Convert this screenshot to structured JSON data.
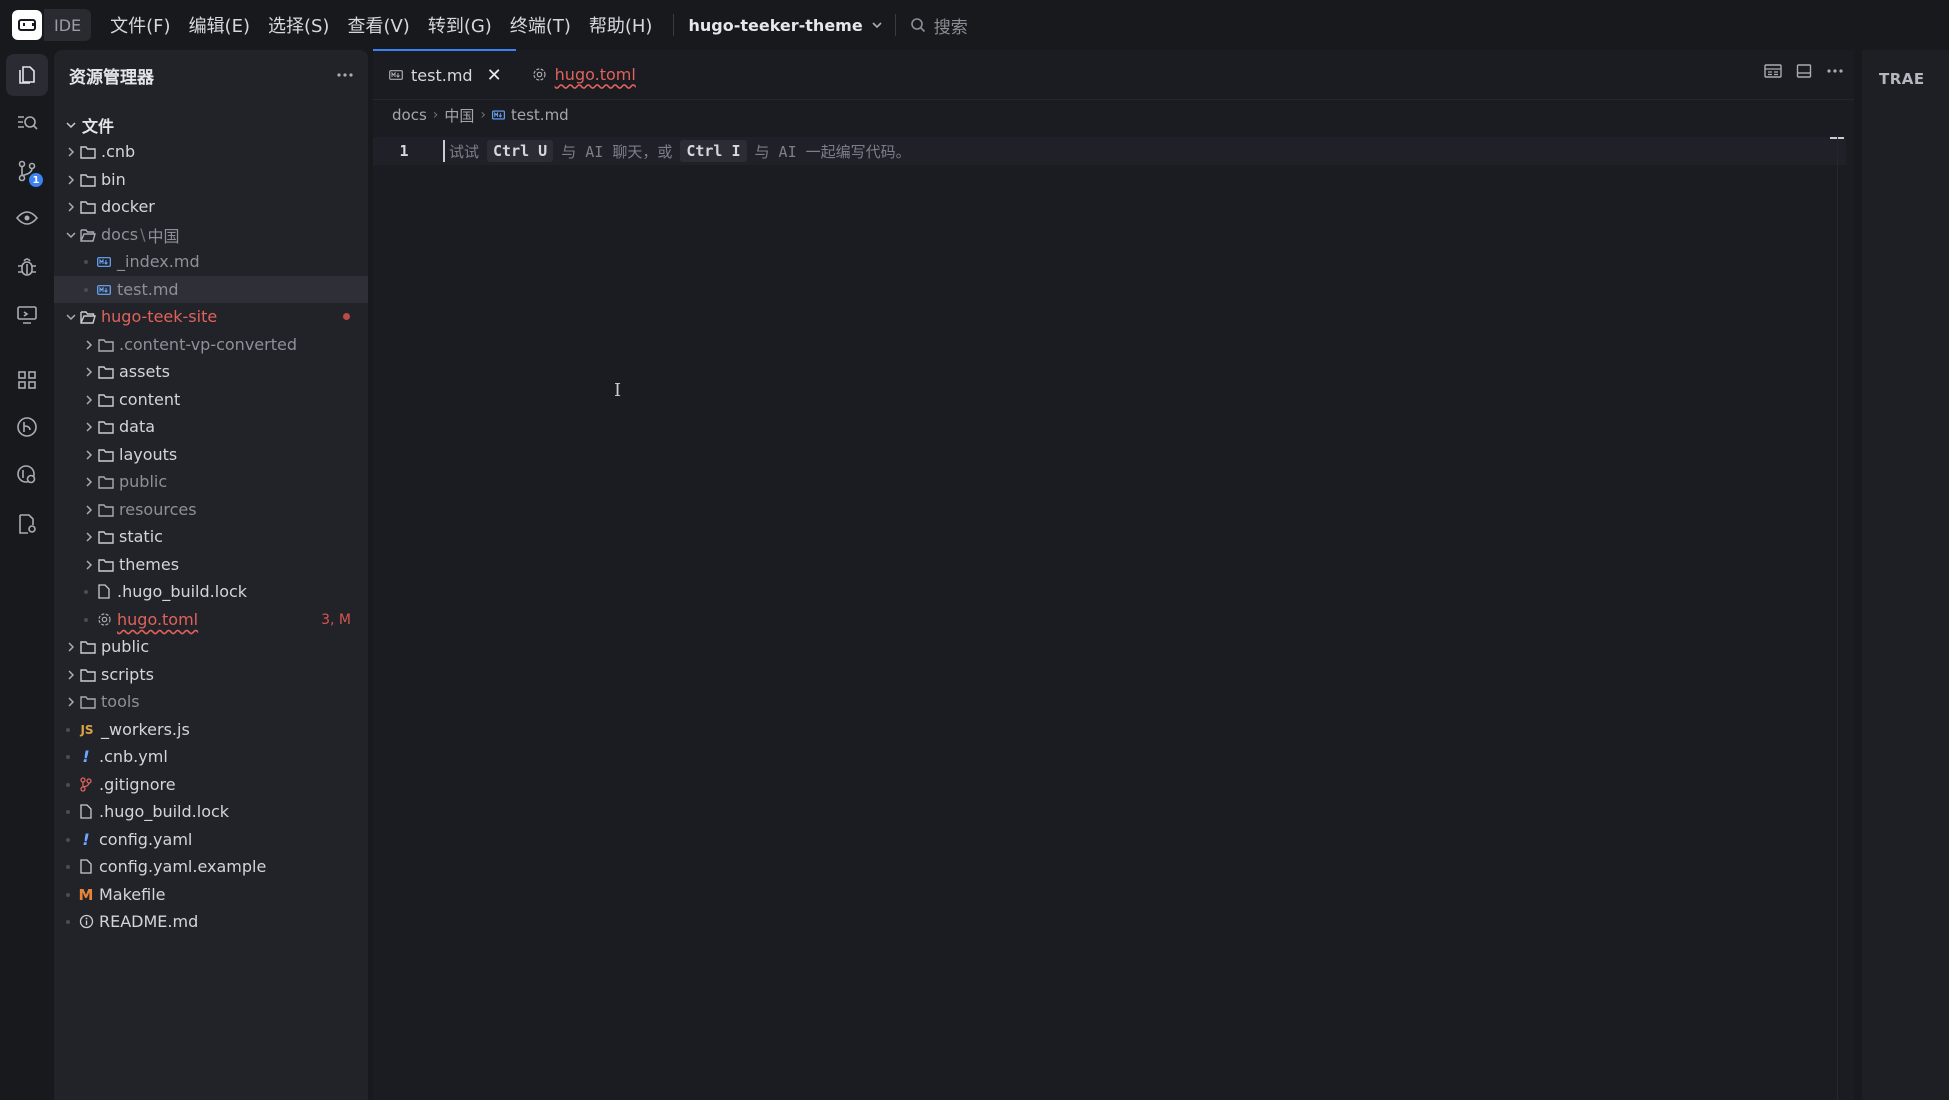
{
  "titlebar": {
    "badge": "IDE",
    "menu": [
      "文件(F)",
      "编辑(E)",
      "选择(S)",
      "查看(V)",
      "转到(G)",
      "终端(T)",
      "帮助(H)"
    ],
    "project": "hugo-teeker-theme",
    "search_placeholder": "搜索"
  },
  "activity": {
    "scm_badge": "1",
    "icons": [
      "explorer-icon",
      "search-icon",
      "source-control-icon",
      "preview-icon",
      "debug-icon",
      "remote-icon",
      "extensions-icon",
      "git-graph-icon",
      "settings-search-icon",
      "config-icon"
    ]
  },
  "sidebar": {
    "title": "资源管理器",
    "root_label": "文件",
    "items": [
      {
        "label": ".cnb"
      },
      {
        "label": "bin"
      },
      {
        "label": "docker"
      },
      {
        "label": "docs",
        "sep": "\\",
        "label2": "中国"
      },
      {
        "label": "_index.md"
      },
      {
        "label": "test.md"
      },
      {
        "label": "hugo-teek-site"
      },
      {
        "label": ".content-vp-converted"
      },
      {
        "label": "assets"
      },
      {
        "label": "content"
      },
      {
        "label": "data"
      },
      {
        "label": "layouts"
      },
      {
        "label": "public"
      },
      {
        "label": "resources"
      },
      {
        "label": "static"
      },
      {
        "label": "themes"
      },
      {
        "label": ".hugo_build.lock"
      },
      {
        "label": "hugo.toml",
        "status": "3, M"
      },
      {
        "label": "public"
      },
      {
        "label": "scripts"
      },
      {
        "label": "tools"
      },
      {
        "label": "_workers.js",
        "icon_text": "JS"
      },
      {
        "label": ".cnb.yml",
        "icon_text": "!"
      },
      {
        "label": ".gitignore"
      },
      {
        "label": ".hugo_build.lock"
      },
      {
        "label": "config.yaml",
        "icon_text": "!"
      },
      {
        "label": "config.yaml.example"
      },
      {
        "label": "Makefile",
        "icon_text": "M"
      },
      {
        "label": "README.md"
      }
    ]
  },
  "editor": {
    "tabs": [
      {
        "label": "test.md"
      },
      {
        "label": "hugo.toml"
      }
    ],
    "breadcrumb": [
      "docs",
      "中国",
      "test.md"
    ],
    "line_number": "1",
    "hint": {
      "pre": "试试",
      "key1": "Ctrl U",
      "mid": "与 AI 聊天，或",
      "key2": "Ctrl I",
      "post": "与 AI 一起编写代码。"
    }
  },
  "right_panel": {
    "title": "TRAE"
  },
  "colors": {
    "accent": "#3b82f6",
    "error": "#e0625b",
    "folder_icon": "#c9ccd3",
    "markdown_icon": "#6aa9ff"
  }
}
